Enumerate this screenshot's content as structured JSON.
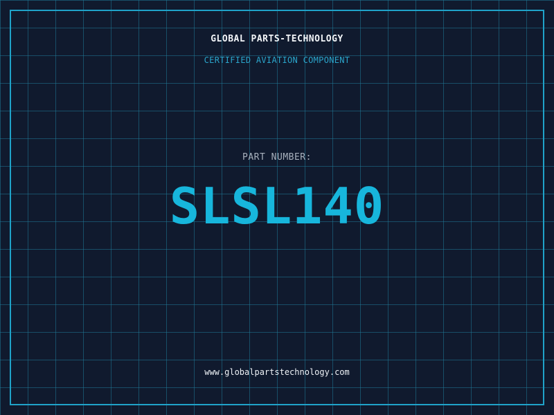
{
  "header": {
    "company_name": "GLOBAL PARTS-TECHNOLOGY",
    "subtitle": "CERTIFIED AVIATION COMPONENT"
  },
  "part": {
    "label": "PART NUMBER:",
    "number": "SLSL140"
  },
  "footer": {
    "website": "www.globalpartstechnology.com"
  },
  "colors": {
    "background": "#101a2e",
    "grid": "#207896",
    "frame": "#1fa3c9",
    "accent": "#17b6dc",
    "label": "#a8b1bd",
    "text": "#f2f5f8"
  }
}
